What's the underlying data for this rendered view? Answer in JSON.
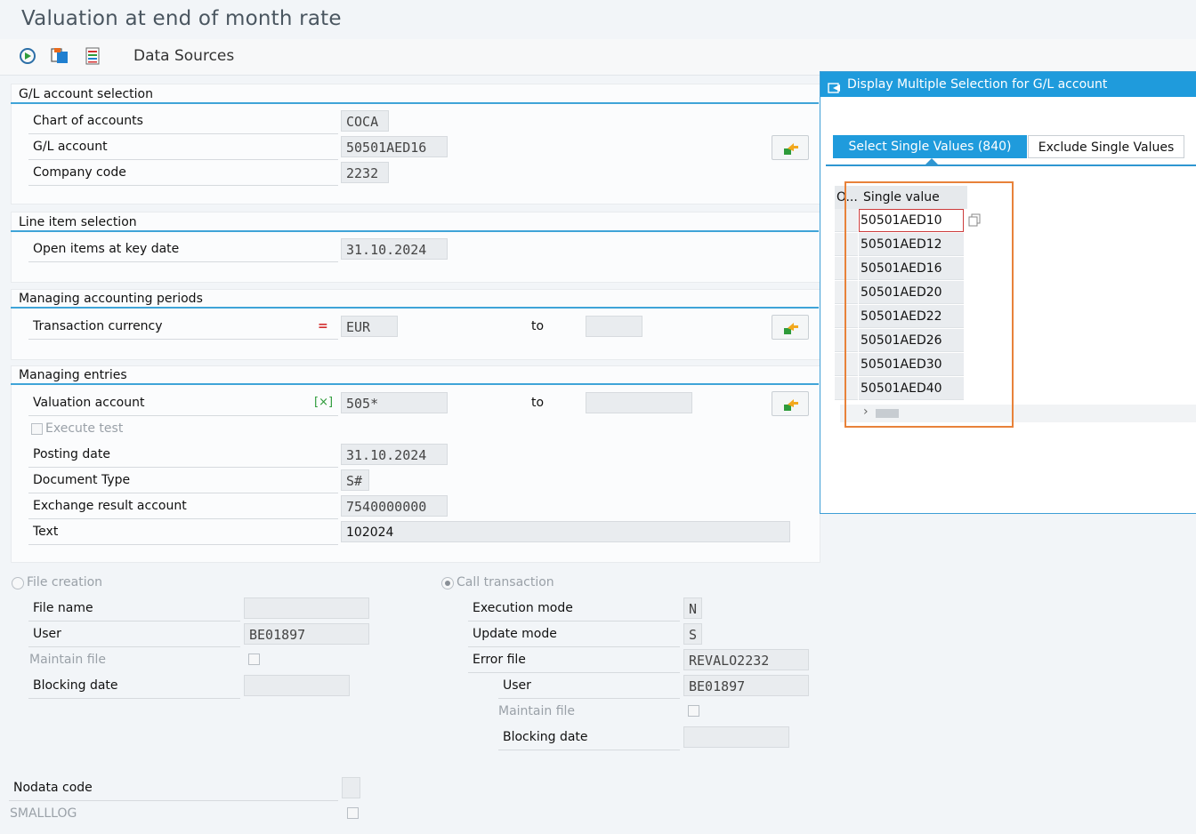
{
  "window": {
    "title": "Valuation at end of month rate"
  },
  "toolbar": {
    "data_sources": "Data Sources",
    "icons": [
      "execute-icon",
      "copy-variant-icon",
      "list-icon"
    ]
  },
  "groups": {
    "gl": {
      "title": "G/L account selection",
      "chart_label": "Chart of accounts",
      "chart_value": "COCA",
      "gl_label": "G/L account",
      "gl_value": "50501AED16",
      "company_label": "Company code",
      "company_value": "2232"
    },
    "line": {
      "title": "Line item selection",
      "open_label": "Open items at key date",
      "open_value": "31.10.2024"
    },
    "periods": {
      "title": "Managing accounting periods",
      "currency_label": "Transaction currency",
      "currency_op": "=",
      "currency_value": "EUR",
      "to_label": "to",
      "to_value": ""
    },
    "entries": {
      "title": "Managing entries",
      "valuation_label": "Valuation account",
      "valuation_op": "[×]",
      "valuation_value": "505*",
      "to_label": "to",
      "to_value": "",
      "execute_test_label": "Execute test",
      "posting_label": "Posting date",
      "posting_value": "31.10.2024",
      "doctype_label": "Document Type",
      "doctype_value": "S#",
      "exchange_label": "Exchange result account",
      "exchange_value": "7540000000",
      "text_label": "Text",
      "text_value": "102024"
    }
  },
  "file_creation": {
    "label": "File creation",
    "file_name_label": "File name",
    "file_name_value": "",
    "user_label": "User",
    "user_value": "BE01897",
    "maintain_label": "Maintain file",
    "blocking_label": "Blocking date",
    "blocking_value": ""
  },
  "call_transaction": {
    "label": "Call transaction",
    "exec_label": "Execution mode",
    "exec_value": "N",
    "update_label": "Update mode",
    "update_value": "S",
    "error_label": "Error file",
    "error_value": "REVALO2232",
    "user_label": "User",
    "user_value": "BE01897",
    "maintain_label": "Maintain file",
    "blocking_label": "Blocking date",
    "blocking_value": ""
  },
  "bottom": {
    "nodata_label": "Nodata code",
    "nodata_value": "",
    "smalllog_label": "SMALLLOG"
  },
  "popup": {
    "title": "Display Multiple Selection for G/L account",
    "tab_select": "Select Single Values (840)",
    "tab_exclude": "Exclude Single Values",
    "col_short": "O...",
    "col_value": "Single value",
    "values": [
      "50501AED10",
      "50501AED12",
      "50501AED16",
      "50501AED20",
      "50501AED22",
      "50501AED26",
      "50501AED30",
      "50501AED40"
    ],
    "scroll_arrow": "›"
  },
  "colors": {
    "accent": "#1f9bdc",
    "highlight": "#e8823a",
    "required": "#d32f2f",
    "include": "#2e9b3a"
  }
}
